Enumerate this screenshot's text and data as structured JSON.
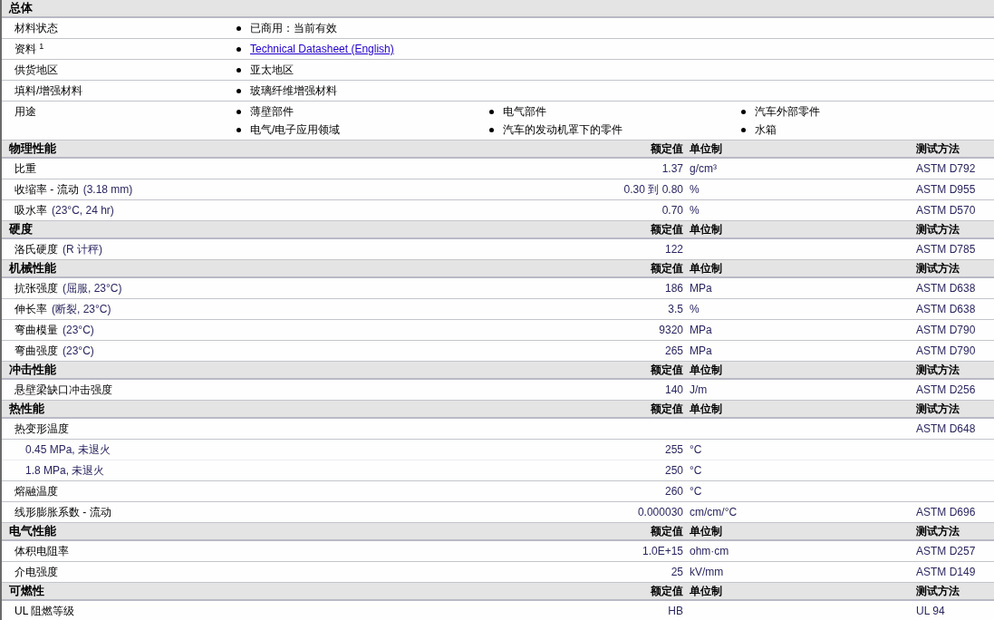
{
  "general": {
    "title": "总体",
    "rows": [
      {
        "kind": "text",
        "label": "材料状态",
        "items": [
          "已商用：当前有效"
        ]
      },
      {
        "kind": "link",
        "label": "资料 $^{1}$",
        "items": [
          "Technical Datasheet (English)"
        ]
      },
      {
        "kind": "text",
        "label": "供货地区",
        "items": [
          "亚太地区"
        ]
      },
      {
        "kind": "text",
        "label": "填料/增强材料",
        "items": [
          "玻璃纤维增强材料"
        ]
      },
      {
        "kind": "columns",
        "label": "用途",
        "items": [
          "薄壁部件",
          "电气部件",
          "汽车外部零件",
          "电气/电子应用领域",
          "汽车的发动机罩下的零件",
          "水箱"
        ]
      }
    ]
  },
  "sections": [
    {
      "title": "物理性能",
      "value_header": "额定值",
      "unit_header": "单位制",
      "method_header": "测试方法",
      "rows": [
        {
          "label": "比重",
          "value": "1.37",
          "unit": "g/cm³",
          "method": "ASTM D792"
        },
        {
          "label": "收缩率  - 流动",
          "condition": "(3.18 mm)",
          "value": "0.30 到  0.80",
          "unit": "%",
          "method": "ASTM D955"
        },
        {
          "label": "吸水率",
          "condition": "(23°C, 24 hr)",
          "value": "0.70",
          "unit": "%",
          "method": "ASTM D570"
        }
      ]
    },
    {
      "title": "硬度",
      "value_header": "额定值",
      "unit_header": "单位制",
      "method_header": "测试方法",
      "rows": [
        {
          "label": "洛氏硬度",
          "condition": "(R 计秤)",
          "value": "122",
          "method": "ASTM D785"
        }
      ]
    },
    {
      "title": "机械性能",
      "value_header": "额定值",
      "unit_header": "单位制",
      "method_header": "测试方法",
      "rows": [
        {
          "label": "抗张强度",
          "condition": "(屈服, 23°C)",
          "value": "186",
          "unit": "MPa",
          "method": "ASTM D638"
        },
        {
          "label": "伸长率",
          "condition": "(断裂, 23°C)",
          "value": "3.5",
          "unit": "%",
          "method": "ASTM D638"
        },
        {
          "label": "弯曲模量",
          "condition": "(23°C)",
          "value": "9320",
          "unit": "MPa",
          "method": "ASTM D790"
        },
        {
          "label": "弯曲强度",
          "condition": "(23°C)",
          "value": "265",
          "unit": "MPa",
          "method": "ASTM D790"
        }
      ]
    },
    {
      "title": "冲击性能",
      "value_header": "额定值",
      "unit_header": "单位制",
      "method_header": "测试方法",
      "rows": [
        {
          "label": "悬壁梁缺口冲击强度",
          "value": "140",
          "unit": "J/m",
          "method": "ASTM D256"
        }
      ]
    },
    {
      "title": "热性能",
      "value_header": "额定值",
      "unit_header": "单位制",
      "method_header": "测试方法",
      "rows": [
        {
          "label": "热变形温度",
          "method": "ASTM D648",
          "children": [
            {
              "label": "0.45 MPa, 未退火",
              "value": "255",
              "unit": "°C"
            },
            {
              "label": "1.8 MPa, 未退火",
              "value": "250",
              "unit": "°C"
            }
          ]
        },
        {
          "label": "熔融温度",
          "value": "260",
          "unit": "°C"
        },
        {
          "label": "线形膨胀系数  - 流动",
          "value": "0.000030",
          "unit": "cm/cm/°C",
          "method": "ASTM D696"
        }
      ]
    },
    {
      "title": "电气性能",
      "value_header": "额定值",
      "unit_header": "单位制",
      "method_header": "测试方法",
      "rows": [
        {
          "label": "体积电阻率",
          "value": "1.0E+15",
          "unit": "ohm·cm",
          "method": "ASTM D257"
        },
        {
          "label": "介电强度",
          "value": "25",
          "unit": "kV/mm",
          "method": "ASTM D149"
        }
      ]
    },
    {
      "title": "可燃性",
      "value_header": "额定值",
      "unit_header": "单位制",
      "method_header": "测试方法",
      "rows": [
        {
          "label": "UL 阻燃等级",
          "value": "HB",
          "method": "UL 94"
        }
      ]
    }
  ]
}
